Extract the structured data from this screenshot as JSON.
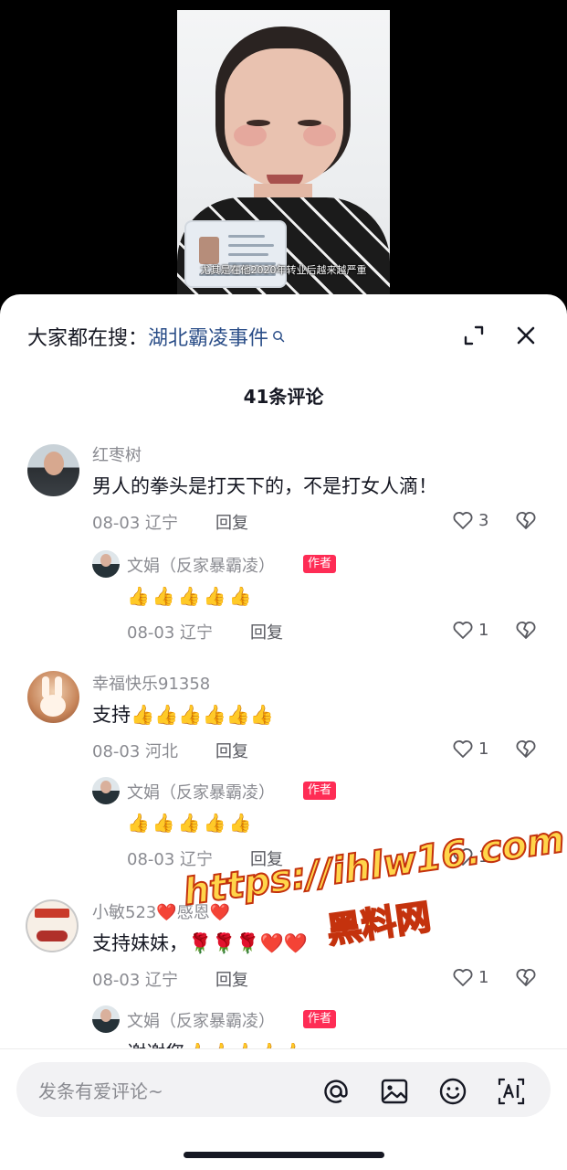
{
  "video": {
    "subtitle": "尤其是在他2020年转业后越来越严重"
  },
  "header": {
    "search_prefix": "大家都在搜：",
    "search_term": "湖北霸凌事件",
    "comment_count": "41条评论"
  },
  "comments": [
    {
      "username": "红枣树",
      "text": "男人的拳头是打天下的，不是打女人滴！",
      "meta": "08-03 辽宁",
      "reply_label": "回复",
      "likes": "3",
      "reply": {
        "username": "文娟（反家暴霸凌）",
        "badge": "作者",
        "text": "👍👍👍👍👍",
        "meta": "08-03 辽宁",
        "reply_label": "回复",
        "likes": "1"
      }
    },
    {
      "username": "幸福快乐91358",
      "text": "支持👍👍👍👍👍👍",
      "meta": "08-03 河北",
      "reply_label": "回复",
      "likes": "1",
      "reply": {
        "username": "文娟（反家暴霸凌）",
        "badge": "作者",
        "text": "👍👍👍👍👍",
        "meta": "08-03 辽宁",
        "reply_label": "回复",
        "likes": "1"
      }
    },
    {
      "username": "小敏523❤️感恩❤️",
      "text": "支持妹妹，🌹🌹🌹❤️❤️",
      "meta": "08-03 辽宁",
      "reply_label": "回复",
      "likes": "1",
      "reply": {
        "username": "文娟（反家暴霸凌）",
        "badge": "作者",
        "text": "谢谢您👍👍👍👍👍"
      }
    }
  ],
  "watermark": {
    "url": "https://ihlw16.com",
    "name": "黑料网"
  },
  "input": {
    "placeholder": "发条有爱评论~"
  },
  "colors": {
    "link_blue": "#2b4e88",
    "author_badge": "#fe2c55",
    "secondary_text": "#8a8b91"
  }
}
